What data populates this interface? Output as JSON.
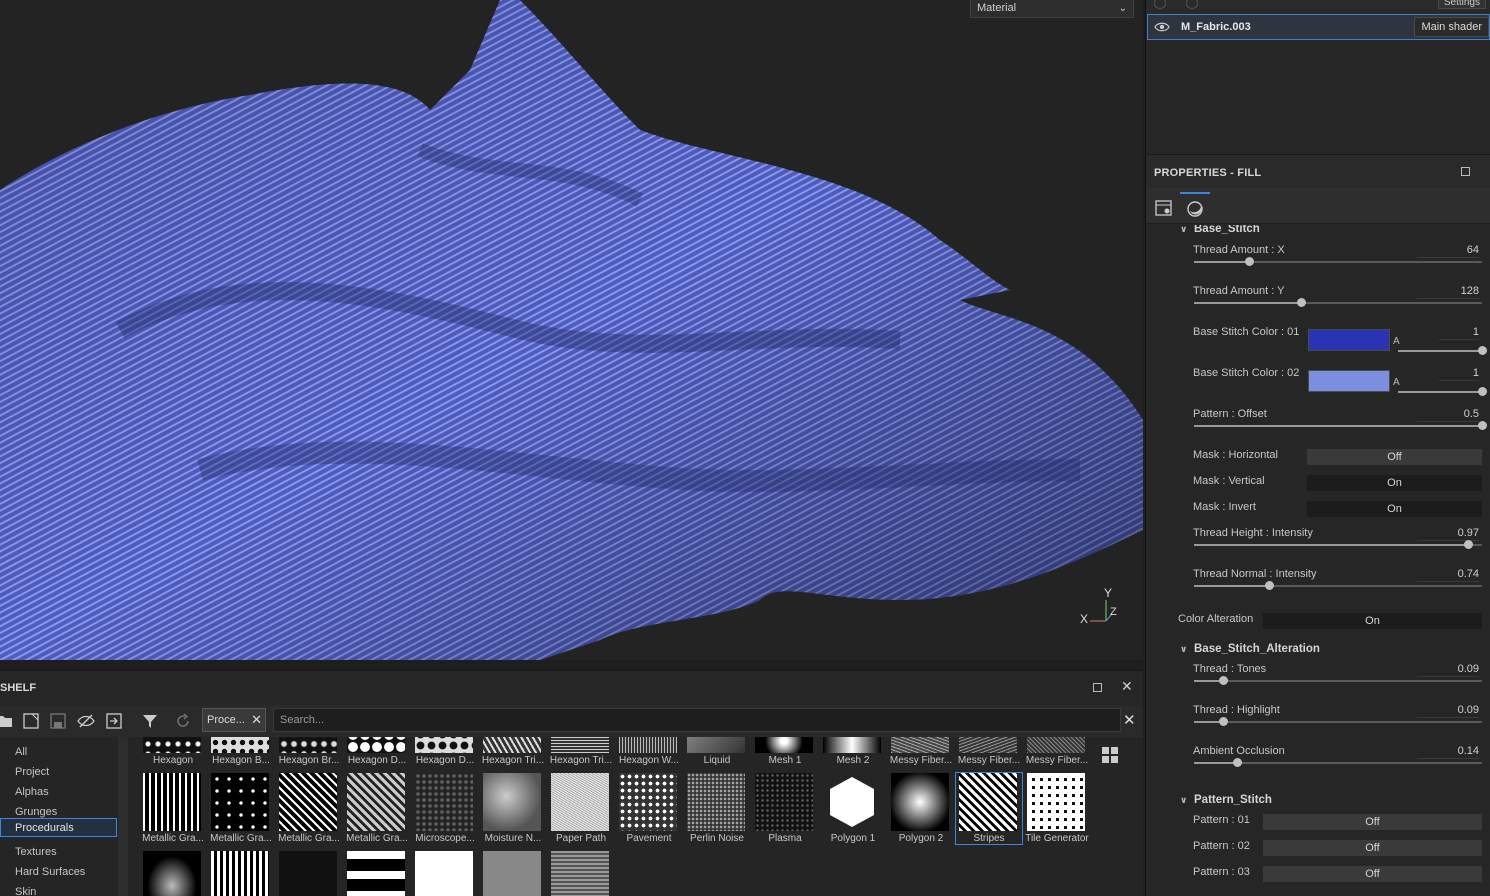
{
  "viewport": {
    "material_select": "Material",
    "gizmo": {
      "y": "Y",
      "x": "X",
      "z": "Z"
    }
  },
  "right_panel": {
    "settings_label": "Settings",
    "material_name": "M_Fabric.003",
    "shader_label": "Main shader",
    "properties_title": "PROPERTIES - FILL",
    "sections": {
      "base_stitch": "Base_Stitch",
      "base_stitch_alteration": "Base_Stitch_Alteration",
      "pattern_stitch": "Pattern_Stitch"
    },
    "params": [
      {
        "label": "Thread Amount : X",
        "value": "64",
        "fraction": 0.19
      },
      {
        "label": "Thread Amount : Y",
        "value": "128",
        "fraction": 0.37
      },
      {
        "label": "Pattern : Offset",
        "value": "0.5",
        "fraction": 1.0
      },
      {
        "label": "Thread Height : Intensity",
        "value": "0.97",
        "fraction": 0.95
      },
      {
        "label": "Thread Normal : Intensity",
        "value": "0.74",
        "fraction": 0.26
      },
      {
        "label": "Thread : Tones",
        "value": "0.09",
        "fraction": 0.1
      },
      {
        "label": "Thread : Highlight",
        "value": "0.09",
        "fraction": 0.1
      },
      {
        "label": "Ambient Occlusion",
        "value": "0.14",
        "fraction": 0.15
      }
    ],
    "colors": [
      {
        "label": "Base Stitch Color : 01",
        "swatch": "#2b33b5",
        "alpha_label": "A",
        "value": "1",
        "fraction": 1.0
      },
      {
        "label": "Base Stitch Color : 02",
        "swatch": "#7b8ee0",
        "alpha_label": "A",
        "value": "1",
        "fraction": 1.0
      }
    ],
    "toggles": [
      {
        "label": "Mask : Horizontal",
        "state": "Off"
      },
      {
        "label": "Mask : Vertical",
        "state": "On"
      },
      {
        "label": "Mask : Invert",
        "state": "On"
      },
      {
        "label": "Color Alteration",
        "state": "On"
      },
      {
        "label": "Pattern : 01",
        "state": "Off"
      },
      {
        "label": "Pattern : 02",
        "state": "Off"
      },
      {
        "label": "Pattern : 03",
        "state": "Off"
      }
    ]
  },
  "shelf": {
    "title": "SHELF",
    "breadcrumb": "Proce...",
    "search_placeholder": "Search...",
    "categories": [
      "All",
      "Project",
      "Alphas",
      "Grunges",
      "Procedurals",
      "Textures",
      "Hard Surfaces",
      "Skin"
    ],
    "selected_category": "Procedurals",
    "row1": [
      "Hexagon",
      "Hexagon B...",
      "Hexagon Br...",
      "Hexagon D...",
      "Hexagon D...",
      "Hexagon Tri...",
      "Hexagon Tri...",
      "Hexagon W...",
      "Liquid",
      "Mesh 1",
      "Mesh 2",
      "Messy Fiber...",
      "Messy Fiber...",
      "Messy Fiber..."
    ],
    "row2": [
      "Metallic Gra...",
      "Metallic Gra...",
      "Metallic Gra...",
      "Metallic Gra...",
      "Microscope...",
      "Moisture N...",
      "Paper Path",
      "Pavement",
      "Perlin Noise",
      "Plasma",
      "Polygon 1",
      "Polygon 2",
      "Stripes",
      "Tile Generator"
    ],
    "selected_item": "Stripes",
    "fabric_color": "#5663c9"
  }
}
